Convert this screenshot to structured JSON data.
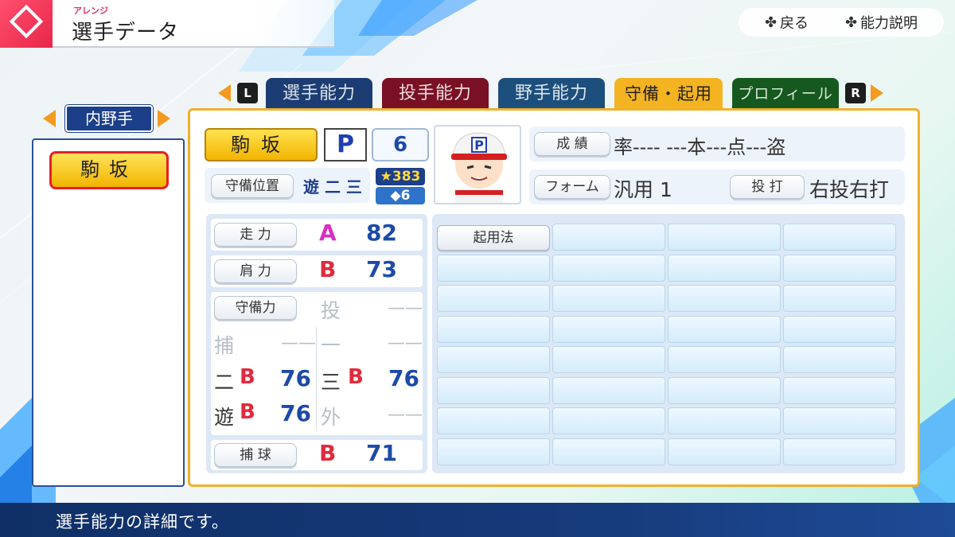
{
  "header": {
    "ruby": "アレンジ",
    "title": "選手データ",
    "help": [
      {
        "glyph": "✤",
        "label": "戻る"
      },
      {
        "glyph": "✤",
        "label": "能力説明"
      }
    ]
  },
  "tabs": {
    "left_button": "L",
    "right_button": "R",
    "items": [
      {
        "label": "選手能力",
        "color": "#1c3d73",
        "active": false
      },
      {
        "label": "投手能力",
        "color": "#7a1024",
        "active": false
      },
      {
        "label": "野手能力",
        "color": "#1d4f7d",
        "active": false
      },
      {
        "label": "守備・起用",
        "color": "#f4b321",
        "active": true
      },
      {
        "label": "プロフィール",
        "color": "#15591e",
        "active": false
      }
    ]
  },
  "sidebar": {
    "category": "内野手",
    "player": "駒坂"
  },
  "player": {
    "name": "駒坂",
    "position_badge": "P",
    "number": "6",
    "star_rating": "★383",
    "diamond_count": "◆6",
    "defense_position_label": "守備位置",
    "defense_positions": "遊 二 三",
    "record_label": "成 績",
    "record_value": "率---- ---本---点---盗",
    "form_label": "フォーム",
    "form_value": "汎用 1",
    "batting_label": "投 打",
    "batting_value": "右投右打"
  },
  "stats": {
    "speed": {
      "label": "走 力",
      "grade": "A",
      "value": "82"
    },
    "arm": {
      "label": "肩 力",
      "grade": "B",
      "value": "73"
    },
    "fielding_label": "守備力",
    "positions": {
      "pitcher": {
        "label": "投",
        "value": "——"
      },
      "catcher": {
        "label": "捕",
        "value": "——"
      },
      "first": {
        "label": "一",
        "value": "——"
      },
      "second": {
        "label": "二",
        "grade": "B",
        "value": "76"
      },
      "third": {
        "label": "三",
        "grade": "B",
        "value": "76"
      },
      "short": {
        "label": "遊",
        "grade": "B",
        "value": "76"
      },
      "outfield": {
        "label": "外",
        "value": "——"
      }
    },
    "catching": {
      "label": "捕 球",
      "grade": "B",
      "value": "71"
    }
  },
  "usage": {
    "header": "起用法"
  },
  "footer": {
    "message": "選手能力の詳細です。"
  }
}
